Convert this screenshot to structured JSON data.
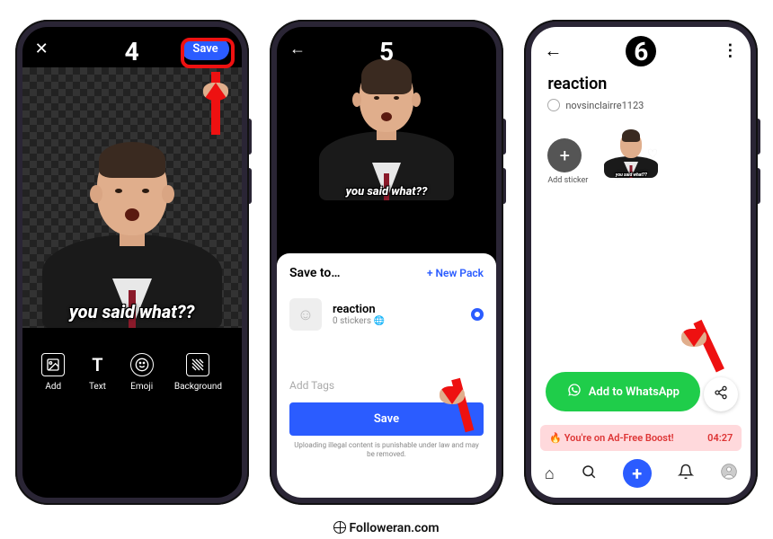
{
  "steps": {
    "s4": "4",
    "s5": "5",
    "s6": "6"
  },
  "phone4": {
    "save_label": "Save",
    "caption": "you said what??",
    "tools": {
      "add": "Add",
      "text": "Text",
      "emoji": "Emoji",
      "bg": "Background"
    }
  },
  "phone5": {
    "caption": "you said what??",
    "sheet_title": "Save to…",
    "new_pack": "+ New Pack",
    "pack_name": "reaction",
    "pack_sub": "0 stickers",
    "tags_placeholder": "Add Tags",
    "save_btn": "Save",
    "disclaimer": "Uploading illegal content is punishable under law and may be removed."
  },
  "phone6": {
    "title": "reaction",
    "username": "novsinclairre1123",
    "add_sticker": "Add sticker",
    "caption": "you said what??",
    "whatsapp_btn": "Add to WhatsApp",
    "boost_text": "You're on Ad-Free Boost!",
    "boost_time": "04:27"
  },
  "footer": "Followeran.com"
}
